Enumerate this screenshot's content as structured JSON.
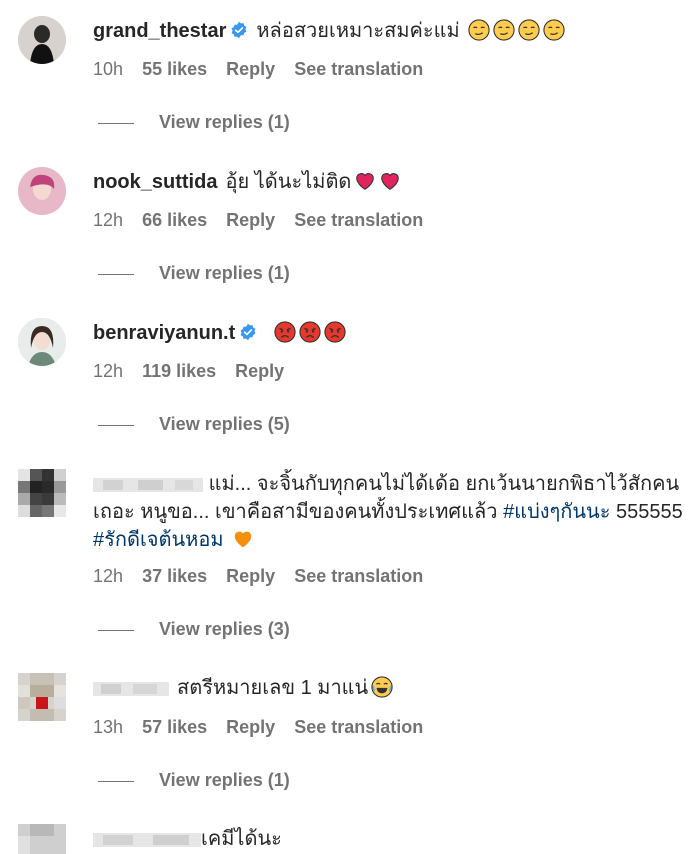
{
  "comments": [
    {
      "username": "grand_thestar",
      "verified": true,
      "text": "หล่อสวยเหมาะสมค่ะแม่",
      "emoji": "smirk-face",
      "time": "10h",
      "likes": "55 likes",
      "reply": "Reply",
      "translate": "See translation",
      "view_replies": "View replies (1)"
    },
    {
      "username": "nook_suttida",
      "verified": false,
      "text": "อุ้ย ได้นะไม่ติด",
      "emoji": "red-heart",
      "time": "12h",
      "likes": "66 likes",
      "reply": "Reply",
      "translate": "See translation",
      "view_replies": "View replies (1)"
    },
    {
      "username": "benraviyanun.t",
      "verified": true,
      "text": "",
      "emoji": "angry-face",
      "time": "12h",
      "likes": "119 likes",
      "reply": "Reply",
      "view_replies": "View replies (5)"
    },
    {
      "username": "",
      "text_line1": "แม่... จะจิ้นกับทุกคนไม่ได้เด้อ ยกเว้นนายกพิธาไว้สักคน",
      "text_line2": "เถอะ หนูขอ... เขาคือสามีของคนทั้งประเทศแล้ว",
      "hashtag1": "#แบ่งๆกันนะ",
      "text_tail": "555555",
      "hashtag2": "#รักดีเจต้นหอม",
      "emoji": "orange-heart",
      "time": "12h",
      "likes": "37 likes",
      "reply": "Reply",
      "translate": "See translation",
      "view_replies": "View replies (3)"
    },
    {
      "username": "",
      "text": "สตรีหมายเลข 1 มาแน่",
      "emoji": "tears-of-joy-face",
      "time": "13h",
      "likes": "57 likes",
      "reply": "Reply",
      "translate": "See translation",
      "view_replies": "View replies (1)"
    },
    {
      "username": "",
      "text": "เคมีได้นะ"
    }
  ],
  "colors": {
    "verified_blue": "#3897f0",
    "hashtag": "#00376b",
    "muted": "#737373",
    "heart_red": "#e0245e",
    "heart_orange": "#f4900c"
  }
}
